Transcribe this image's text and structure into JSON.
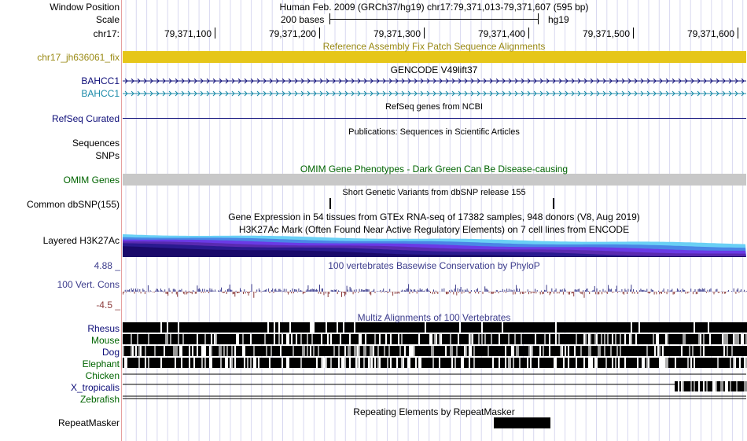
{
  "labels": {
    "window_position": "Window Position",
    "scale": "Scale",
    "chrom": "chr17:",
    "fix_patch": "chr17_jh636061_fix",
    "gencode_1": "BAHCC1",
    "gencode_2": "BAHCC1",
    "refseq": "RefSeq Curated",
    "sequences": "Sequences",
    "snps": "SNPs",
    "omim": "OMIM Genes",
    "dbsnp": "Common dbSNP(155)",
    "h3k27ac": "Layered H3K27Ac",
    "cons_max": "4.88 _",
    "cons_label": "100 Vert. Cons",
    "cons_min": "-4.5 _",
    "rhesus": "Rhesus",
    "mouse": "Mouse",
    "dog": "Dog",
    "elephant": "Elephant",
    "chicken": "Chicken",
    "x_tropicalis": "X_tropicalis",
    "zebrafish": "Zebrafish",
    "repeatmasker": "RepeatMasker"
  },
  "header": {
    "position_title": "Human Feb. 2009 (GRCh37/hg19)   chr17:79,371,013-79,371,607 (595 bp)",
    "scale_text": "200 bases",
    "assembly": "hg19",
    "ticks": [
      "79,371,100",
      "79,371,200",
      "79,371,300",
      "79,371,400",
      "79,371,500",
      "79,371,600"
    ]
  },
  "tracks": {
    "fix_patch_title": "Reference Assembly Fix Patch Sequence Alignments",
    "gencode_title": "GENCODE V49lift37",
    "refseq_title": "RefSeq genes from NCBI",
    "publications_title": "Publications: Sequences in Scientific Articles",
    "omim_title": "OMIM Gene Phenotypes - Dark Green Can Be Disease-causing",
    "dbsnp_title": "Short Genetic Variants from dbSNP release 155",
    "gtex_title": "Gene Expression in 54 tissues from GTEx RNA-seq of 17382 samples, 948 donors (V8, Aug 2019)",
    "h3k27ac_title": "H3K27Ac Mark (Often Found Near Active Regulatory Elements) on 7 cell lines from ENCODE",
    "phylop_title": "100 vertebrates Basewise Conservation by PhyloP",
    "multiz_title": "Multiz Alignments of 100 Vertebrates",
    "repeat_title": "Repeating Elements by RepeatMasker"
  },
  "colors": {
    "fix_patch": "#e6c619",
    "fix_patch_label": "#9a8a14",
    "gencode_1": "#0c0c78",
    "gencode_2": "#1a8aa8",
    "refseq": "#0c0c78",
    "omim_label": "#006400",
    "omim_bar": "#c8c8c8",
    "phylop_pos": "#3c3c8c",
    "phylop_neg": "#8c3c3c",
    "cons_label": "#3c3c8c",
    "multiz_title": "#3c3c8c",
    "rhesus_label": "#0c0c78",
    "species_label": "#006400",
    "h3k27ac_layers": [
      "#6ad0f5",
      "#4a86e6",
      "#6a3ae6",
      "#5a2ab0",
      "#2a1a90",
      "#1a0a6a"
    ]
  }
}
